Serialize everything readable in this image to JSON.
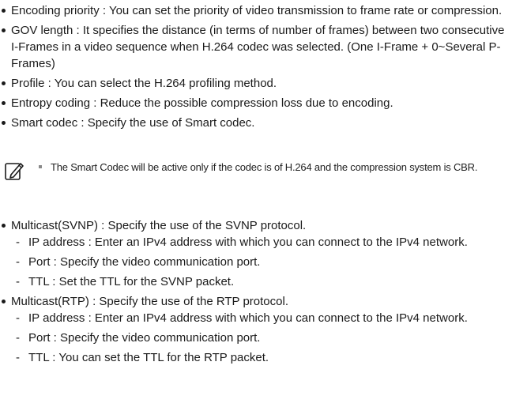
{
  "top_items": [
    "Encoding priority : You can set the priority of video transmission to frame rate or compression.",
    "GOV length : It specifies the distance (in terms of number of frames) between two consecutive I-Frames in a video sequence when H.264 codec was selected. (One I-Frame + 0~Several P-Frames)",
    "Profile : You can select the H.264 profiling method.",
    "Entropy coding : Reduce the possible compression loss due to encoding.",
    "Smart codec : Specify the use of Smart codec."
  ],
  "note": {
    "icon": "memo-pencil-icon",
    "text": "The Smart Codec will be active only if the codec is of H.264 and the compression system is CBR."
  },
  "multicast_svnp": {
    "label": "Multicast(SVNP) : Specify the use of the SVNP protocol.",
    "sub_items": [
      "IP address : Enter an IPv4 address with which you can connect to the IPv4 network.",
      "Port : Specify the video communication port.",
      "TTL : Set the TTL for the SVNP packet."
    ]
  },
  "multicast_rtp": {
    "label": "Multicast(RTP) : Specify the use of the RTP protocol.",
    "sub_items": [
      "IP address : Enter an IPv4 address with which you can connect to the IPv4 network.",
      "Port : Specify the video communication port.",
      "TTL : You can set the TTL for the RTP packet."
    ]
  }
}
